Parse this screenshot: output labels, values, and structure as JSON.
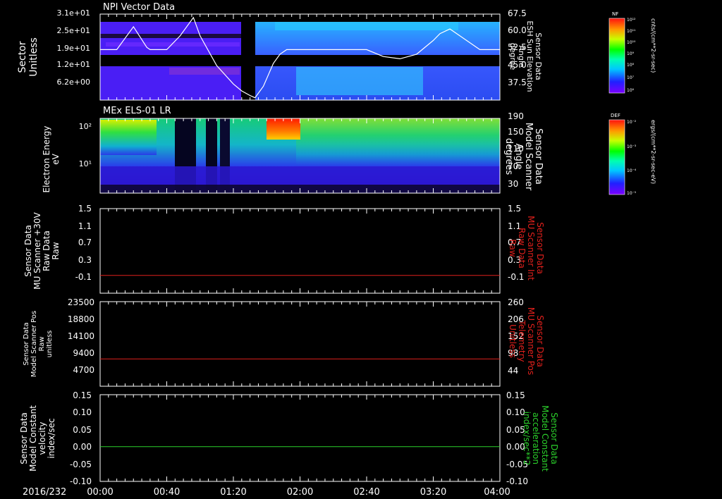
{
  "colors": {
    "background": "#000000",
    "axis": "#ffffff",
    "red_trace": "#e0201c",
    "green_trace": "#2bd12b",
    "white_trace": "#ffffff"
  },
  "chart_data": [
    {
      "type": "heatmap",
      "title": "NPI Vector Data",
      "left_ylabel": [
        "Sector",
        "Unitless"
      ],
      "left_yticks": [
        "3.1e+01",
        "2.5e+01",
        "1.9e+01",
        "1.2e+01",
        "6.2e+00"
      ],
      "right_ylabel": [
        "Sensor Data",
        "ESH Sun Elevation",
        "Angle",
        "degree"
      ],
      "right_yticks": [
        "67.5",
        "60.0",
        "52.5",
        "45.0",
        "37.5"
      ],
      "right_ylim": [
        30.0,
        67.5
      ],
      "colorbar": {
        "label": "NF",
        "unit": "cnts/(cm**2-sr-sec)",
        "ticks": [
          "10¹²",
          "10¹¹",
          "10¹⁰",
          "10⁹",
          "10⁸",
          "10⁷",
          "10⁶"
        ]
      },
      "line_series": {
        "name": "ESH Sun Elevation",
        "x_min": [
          0,
          10,
          20,
          28,
          30,
          40,
          48,
          56,
          60,
          70,
          80,
          85,
          90,
          93,
          98,
          104,
          108,
          112,
          116,
          120,
          140,
          160,
          170,
          180,
          190,
          200,
          204,
          210,
          216,
          228,
          240
        ],
        "y": [
          52,
          52,
          62,
          53,
          52,
          52,
          58,
          66,
          58,
          45,
          37,
          34,
          32,
          31,
          36,
          46,
          50,
          52,
          52,
          52,
          52,
          52,
          49,
          48,
          50,
          56,
          59,
          61,
          58,
          52,
          52
        ]
      }
    },
    {
      "type": "heatmap",
      "title": "MEx ELS-01 LR",
      "left_ylabel": [
        "Electron Energy",
        "eV"
      ],
      "left_yticks": [
        "10²",
        "10¹"
      ],
      "right_ylabel": [
        "Sensor Data",
        "Model Scanner",
        "Angle",
        "degrees"
      ],
      "right_yticks": [
        "190",
        "150",
        "110",
        "70",
        "30"
      ],
      "colorbar": {
        "label": "DEF",
        "unit": "ergs/(cm**2-sr-sec-eV)",
        "ticks": [
          "10⁻²",
          "10⁻³",
          "10⁻⁴",
          "10⁻⁵"
        ]
      }
    },
    {
      "type": "line",
      "left_ylabel": [
        "Sensor Data",
        "MU Scanner +30V",
        "Raw Data",
        "Raw"
      ],
      "left_yticks": [
        "1.5",
        "1.1",
        "0.7",
        "0.3",
        "-0.1"
      ],
      "left_ylim": [
        -0.4,
        1.5
      ],
      "right_ylabel": [
        "Sensor Data",
        "MU Scanner Int",
        "Raw Data",
        "Raw"
      ],
      "right_yticks": [
        "1.5",
        "1.1",
        "0.7",
        "0.3",
        "-0.1"
      ],
      "series": [
        {
          "name": "MU Scanner Int",
          "color": "red",
          "value": 0.0
        }
      ]
    },
    {
      "type": "line",
      "left_ylabel": [
        "Sensor Data",
        "Model Scanner Pos",
        "Raw",
        "unitless"
      ],
      "left_yticks": [
        "23500",
        "18800",
        "14100",
        "9400",
        "4700"
      ],
      "left_ylim": [
        0,
        23500
      ],
      "right_ylabel": [
        "Sensor Data",
        "MU Scanner Pos",
        "Telemetry",
        "Unitless"
      ],
      "right_yticks": [
        "260",
        "206",
        "152",
        "98",
        "44"
      ],
      "series": [
        {
          "name": "MU Scanner Pos Telemetry",
          "color": "red",
          "value": 7600
        }
      ]
    },
    {
      "type": "line",
      "left_ylabel": [
        "Sensor Data",
        "Model Constant",
        "velocity",
        "index/sec"
      ],
      "left_yticks": [
        "0.15",
        "0.10",
        "0.05",
        "0.00",
        "-0.05",
        "-0.10"
      ],
      "left_ylim": [
        -0.1,
        0.15
      ],
      "right_ylabel": [
        "Sensor Data",
        "Model Constant",
        "acceleration",
        "index/sec**2"
      ],
      "right_yticks": [
        "0.15",
        "0.10",
        "0.05",
        "0.00",
        "-0.05",
        "-0.10"
      ],
      "series": [
        {
          "name": "Model Constant acceleration",
          "color": "green",
          "value": 0.0
        }
      ]
    }
  ],
  "time_axis": {
    "date": "2016/232",
    "ticks": [
      "00:00",
      "00:40",
      "01:20",
      "02:00",
      "02:40",
      "03:20",
      "04:00"
    ]
  }
}
